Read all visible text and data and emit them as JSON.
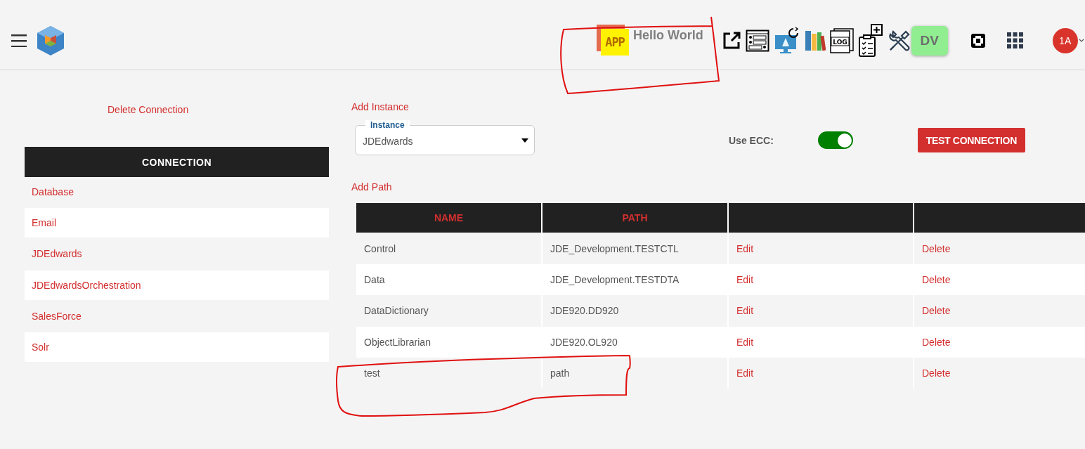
{
  "header": {
    "app_badge": "APP",
    "app_title": "Hello World",
    "dv_badge": "DV",
    "avatar": "1A",
    "log_icon_text": "LOG"
  },
  "sidebar": {
    "delete_link": "Delete Connection",
    "heading": "CONNECTION",
    "items": [
      {
        "label": "Database"
      },
      {
        "label": "Email"
      },
      {
        "label": "JDEdwards"
      },
      {
        "label": "JDEdwardsOrchestration"
      },
      {
        "label": "SalesForce"
      },
      {
        "label": "Solr"
      }
    ]
  },
  "instance": {
    "add_link": "Add Instance",
    "field_label": "Instance",
    "value": "JDEdwards",
    "use_ecc": {
      "label": "Use ECC:",
      "on": true
    },
    "test_button": "TEST CONNECTION"
  },
  "paths": {
    "add_link": "Add Path",
    "columns": [
      "NAME",
      "PATH"
    ],
    "rows": [
      {
        "name": "Control",
        "path": "JDE_Development.TESTCTL",
        "edit": "Edit",
        "delete": "Delete"
      },
      {
        "name": "Data",
        "path": "JDE_Development.TESTDTA",
        "edit": "Edit",
        "delete": "Delete"
      },
      {
        "name": "DataDictionary",
        "path": "JDE920.DD920",
        "edit": "Edit",
        "delete": "Delete"
      },
      {
        "name": "ObjectLibrarian",
        "path": "JDE920.OL920",
        "edit": "Edit",
        "delete": "Delete"
      },
      {
        "name": "test",
        "path": "path",
        "edit": "Edit",
        "delete": "Delete"
      }
    ]
  }
}
